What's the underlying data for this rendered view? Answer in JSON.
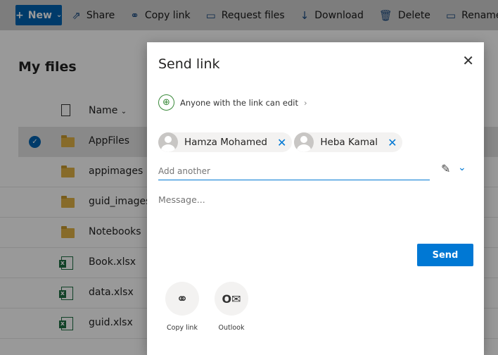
{
  "toolbar": {
    "new_label": "New",
    "items": [
      {
        "label": "Share",
        "icon": "share-icon"
      },
      {
        "label": "Copy link",
        "icon": "link-icon"
      },
      {
        "label": "Request files",
        "icon": "request-files-icon"
      },
      {
        "label": "Download",
        "icon": "download-icon"
      },
      {
        "label": "Delete",
        "icon": "trash-icon"
      },
      {
        "label": "Rename",
        "icon": "rename-icon"
      }
    ]
  },
  "page": {
    "title": "My files",
    "column_name": "Name"
  },
  "files": [
    {
      "name": "AppFiles",
      "type": "folder",
      "selected": true
    },
    {
      "name": "appimages",
      "type": "folder"
    },
    {
      "name": "guid_images",
      "type": "folder"
    },
    {
      "name": "Notebooks",
      "type": "folder"
    },
    {
      "name": "Book.xlsx",
      "type": "excel"
    },
    {
      "name": "data.xlsx",
      "type": "excel"
    },
    {
      "name": "guid.xlsx",
      "type": "excel"
    }
  ],
  "dialog": {
    "title": "Send link",
    "permission": "Anyone with the link can edit",
    "recipients": [
      "Hamza Mohamed",
      "Heba Kamal"
    ],
    "add_placeholder": "Add another",
    "message_placeholder": "Message...",
    "send_label": "Send",
    "share_options": [
      "Copy link",
      "Outlook"
    ],
    "accent": "#0078d4"
  }
}
